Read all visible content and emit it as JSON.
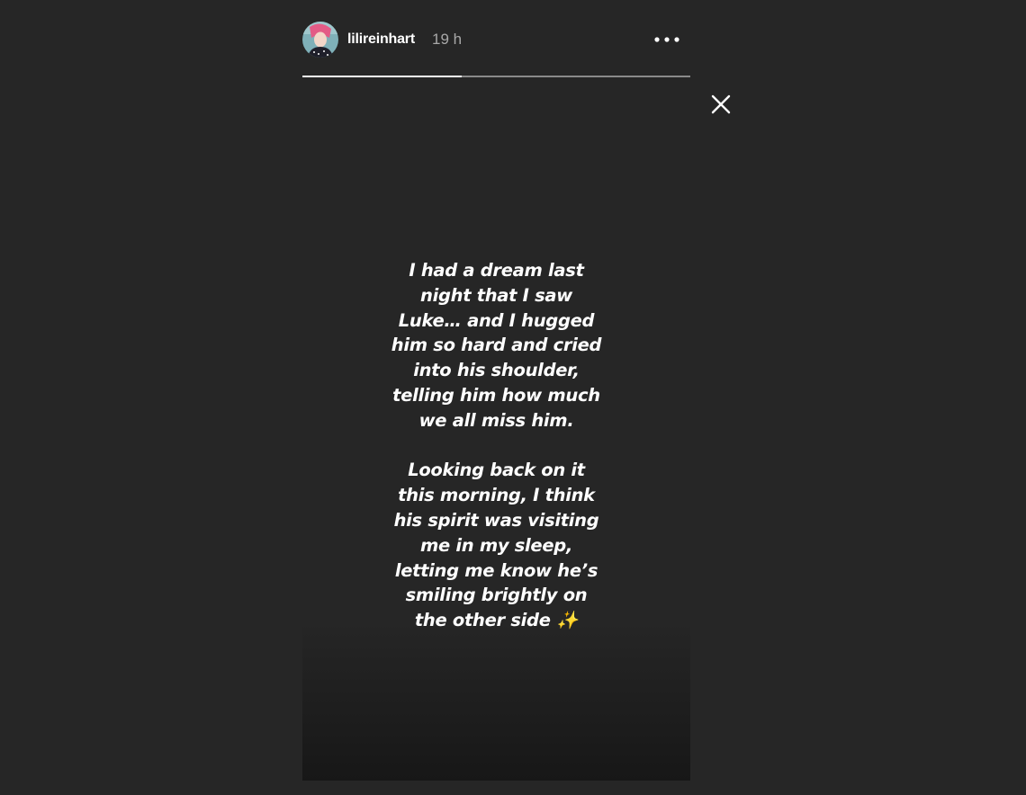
{
  "story": {
    "user": {
      "username": "lilireinhart",
      "avatar_icon": "profile-avatar",
      "time_ago": "19 h"
    },
    "progress": {
      "segments": 2,
      "current_segment": 1,
      "fill_fraction": 0.41,
      "fill_color": "#ffffff",
      "track_color": "#8a8a8a"
    },
    "more_icon": "more-options-icon",
    "close_icon": "close-icon",
    "caption": {
      "paragraph_1": "I had a dream last\nnight that I saw\nLuke… and I hugged\nhim so hard and cried\ninto his shoulder,\ntelling him how much\nwe all miss him.",
      "paragraph_2": "Looking back on it\nthis morning, I think\nhis spirit was visiting\nme in my sleep,\nletting me know he’s\nsmiling brightly on\nthe other side ✨"
    }
  },
  "colors": {
    "page_background": "#262626",
    "text": "#ffffff",
    "timestamp": "#a8a8a8"
  }
}
